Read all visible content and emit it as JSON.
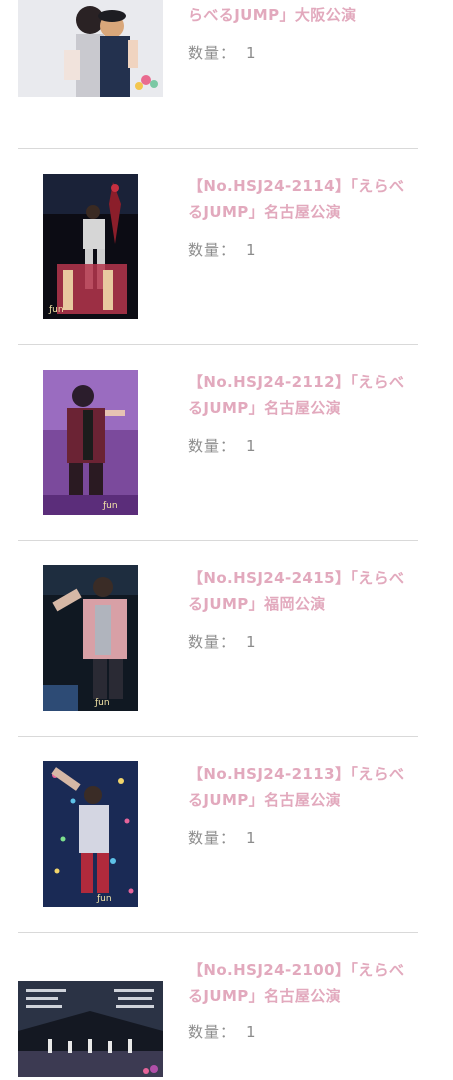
{
  "qty_label": "数量：",
  "items": [
    {
      "title": "らべるJUMP」大阪公演",
      "qty": "1",
      "photo": "two-members-photo"
    },
    {
      "title": "【No.HSJ24-2114】「えらべるJUMP」名古屋公演",
      "qty": "1",
      "photo": "stage-member-with-flowers-photo"
    },
    {
      "title": "【No.HSJ24-2112】「えらべるJUMP」名古屋公演",
      "qty": "1",
      "photo": "member-purple-stage-photo"
    },
    {
      "title": "【No.HSJ24-2415】「えらべるJUMP」福岡公演",
      "qty": "1",
      "photo": "member-pink-jacket-photo"
    },
    {
      "title": "【No.HSJ24-2113】「えらべるJUMP」名古屋公演",
      "qty": "1",
      "photo": "member-glitter-stage-photo"
    },
    {
      "title": "【No.HSJ24-2100】「えらべるJUMP」名古屋公演",
      "qty": "1",
      "photo": "group-stage-message-photo"
    }
  ]
}
